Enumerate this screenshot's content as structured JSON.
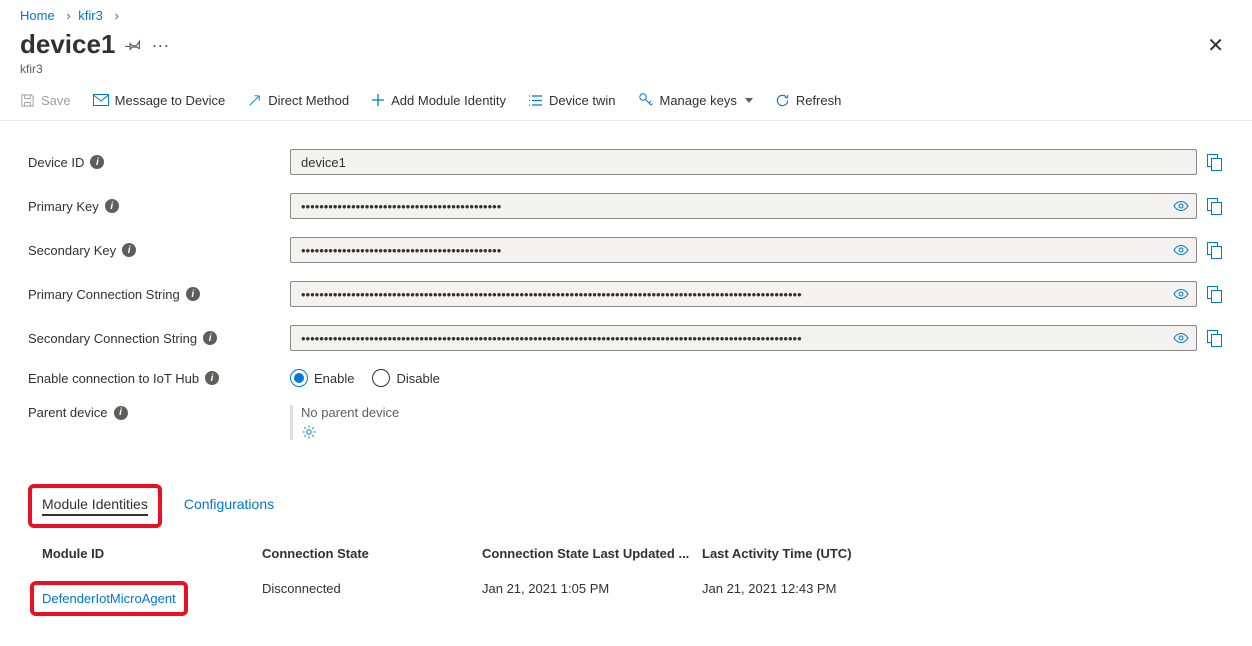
{
  "breadcrumb": {
    "home": "Home",
    "hub": "kfir3"
  },
  "header": {
    "title": "device1",
    "subtitle": "kfir3"
  },
  "commands": {
    "save": "Save",
    "message": "Message to Device",
    "direct": "Direct Method",
    "addModule": "Add Module Identity",
    "deviceTwin": "Device twin",
    "manageKeys": "Manage keys",
    "refresh": "Refresh"
  },
  "labels": {
    "deviceId": "Device ID",
    "primaryKey": "Primary Key",
    "secondaryKey": "Secondary Key",
    "primaryConn": "Primary Connection String",
    "secondaryConn": "Secondary Connection String",
    "enableConn": "Enable connection to IoT Hub",
    "parentDevice": "Parent device"
  },
  "fields": {
    "deviceId": "device1",
    "primaryKey": "••••••••••••••••••••••••••••••••••••••••••••",
    "secondaryKey": "••••••••••••••••••••••••••••••••••••••••••••",
    "primaryConn": "••••••••••••••••••••••••••••••••••••••••••••••••••••••••••••••••••••••••••••••••••••••••••••••••••••••••••••••",
    "secondaryConn": "••••••••••••••••••••••••••••••••••••••••••••••••••••••••••••••••••••••••••••••••••••••••••••••••••••••••••••••"
  },
  "radioOptions": {
    "enable": "Enable",
    "disable": "Disable",
    "selected": "enable"
  },
  "parent": {
    "none": "No parent device"
  },
  "tabs": {
    "moduleIdentities": "Module Identities",
    "configurations": "Configurations"
  },
  "table": {
    "headers": {
      "moduleId": "Module ID",
      "connState": "Connection State",
      "connUpdated": "Connection State Last Updated ...",
      "lastActivity": "Last Activity Time (UTC)"
    },
    "rows": [
      {
        "moduleId": "DefenderIotMicroAgent",
        "connState": "Disconnected",
        "connUpdated": "Jan 21, 2021 1:05 PM",
        "lastActivity": "Jan 21, 2021 12:43 PM"
      }
    ]
  },
  "colors": {
    "accent": "#0078d4",
    "highlight": "#e81123"
  }
}
